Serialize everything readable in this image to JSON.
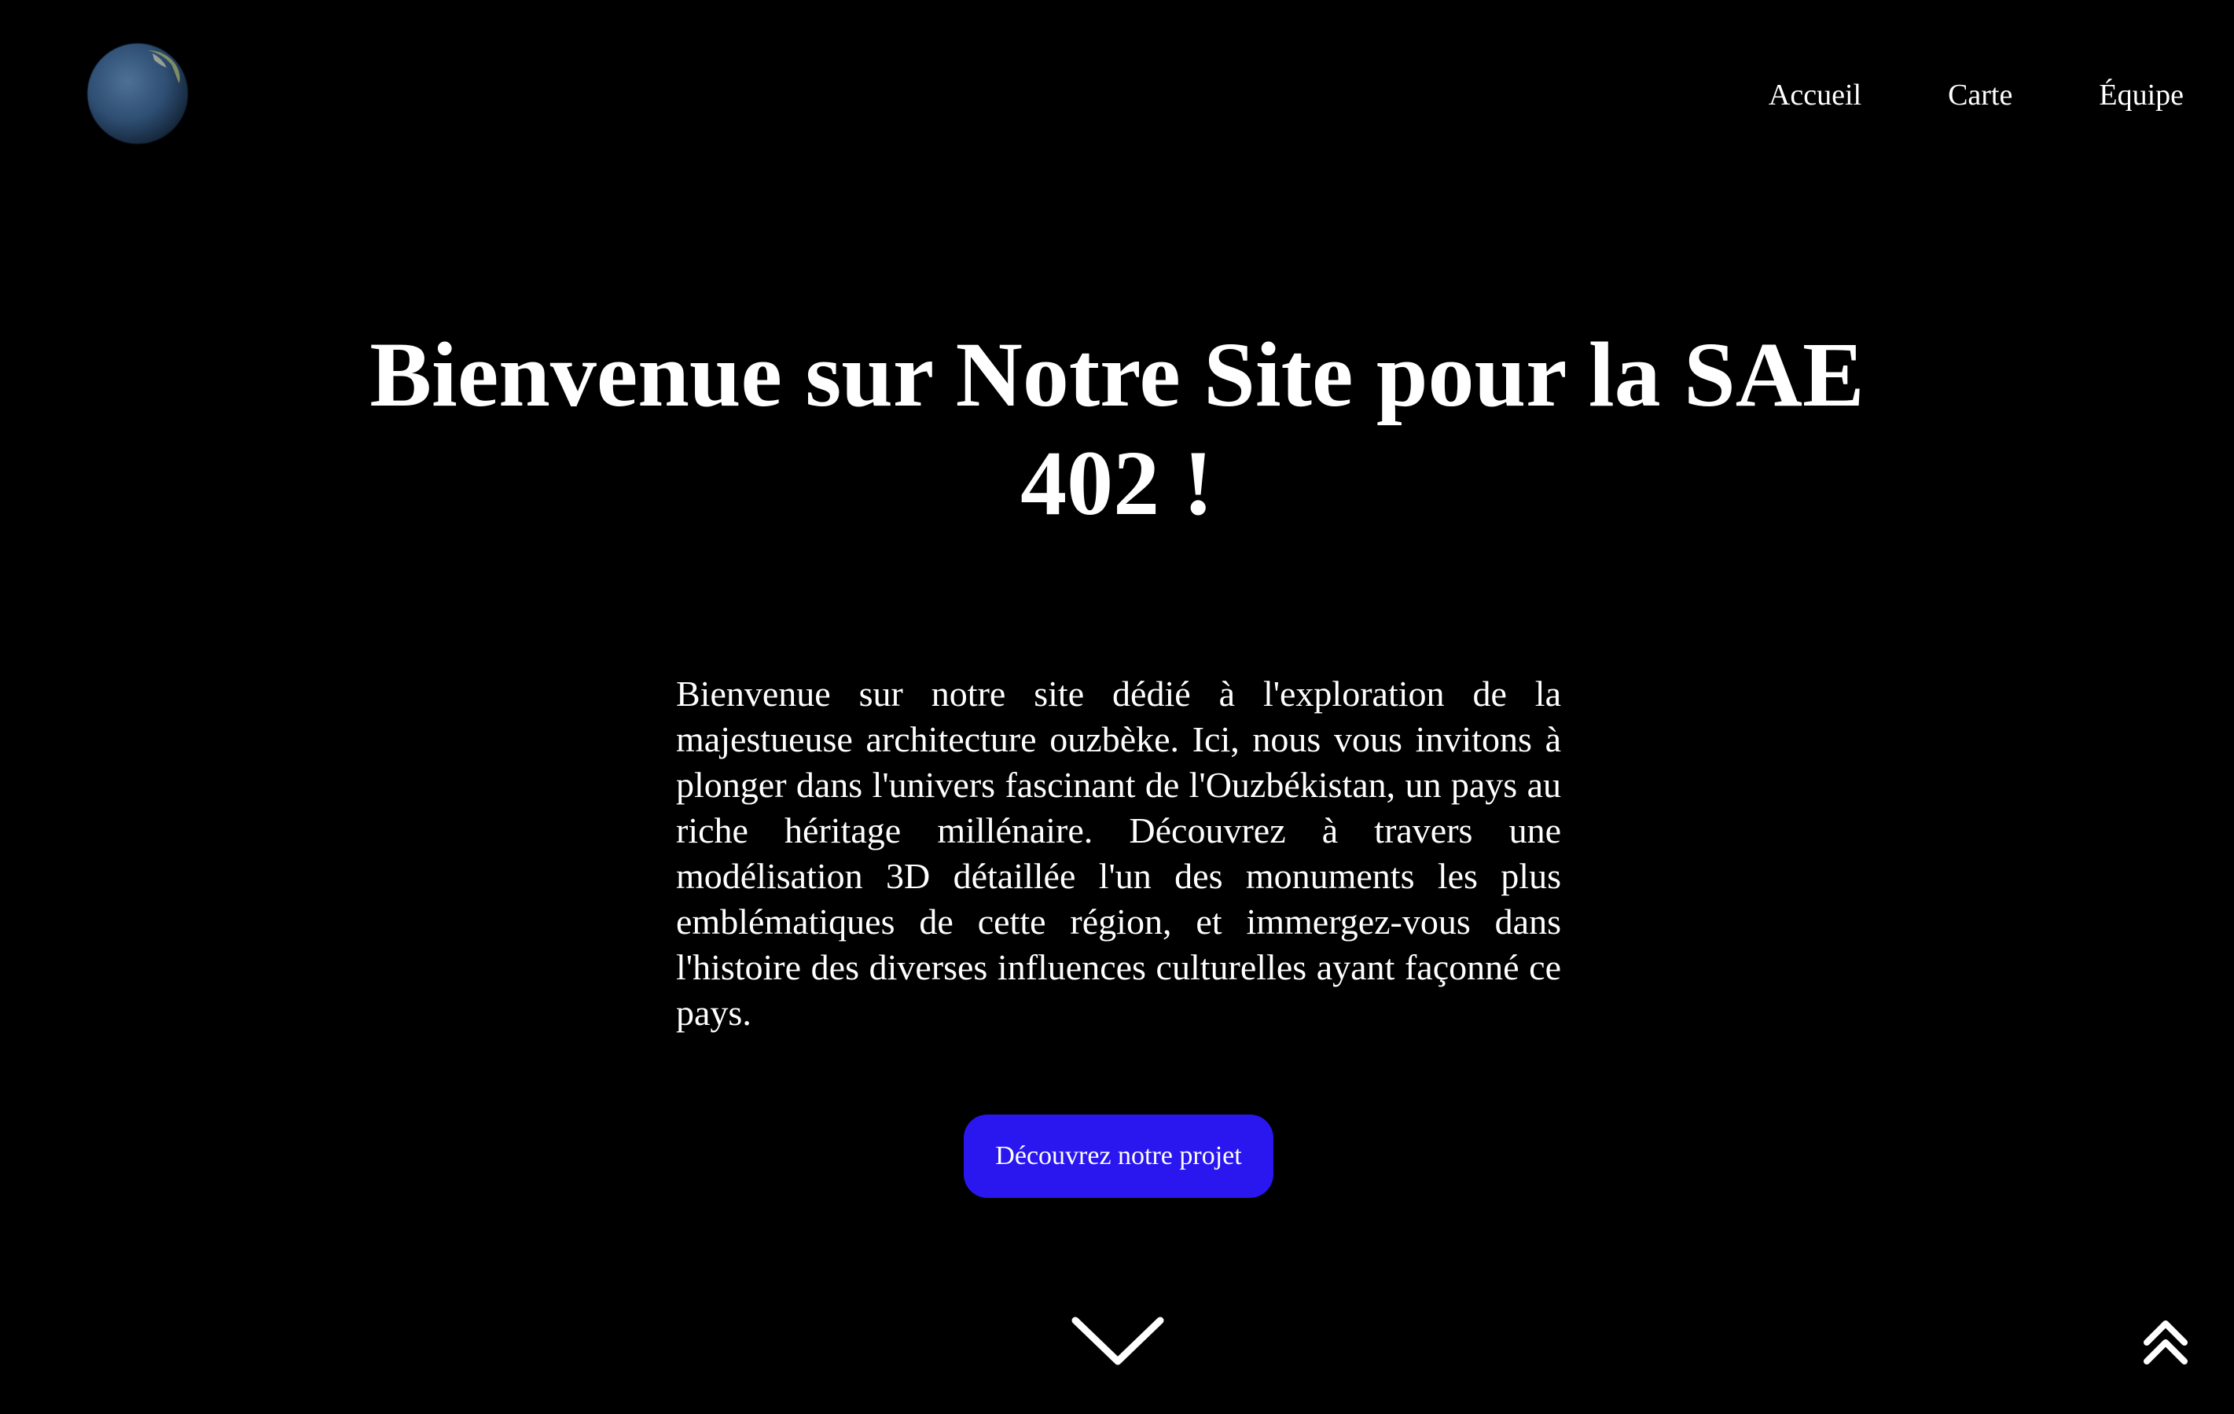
{
  "header": {
    "logo_icon": "globe-icon",
    "nav": [
      {
        "label": "Accueil"
      },
      {
        "label": "Carte"
      },
      {
        "label": "Équipe"
      }
    ]
  },
  "hero": {
    "title": "Bienvenue sur Notre Site pour la SAE 402 !",
    "intro": "Bienvenue sur notre site dédié à l'exploration de la majestueuse architecture ouzbèke. Ici, nous vous invitons à plonger dans l'univers fascinant de l'Ouzbékistan, un pays au riche héritage millénaire. Découvrez à travers une modélisation 3D détaillée l'un des monuments les plus emblématiques de cette région, et immergez-vous dans l'histoire des diverses influences culturelles ayant façonné ce pays.",
    "cta_label": "Découvrez notre projet"
  },
  "icons": {
    "scroll_down": "chevron-down-icon",
    "back_to_top": "double-chevron-up-icon"
  },
  "colors": {
    "background": "#000000",
    "text": "#ffffff",
    "cta_background": "#2a17f0"
  }
}
